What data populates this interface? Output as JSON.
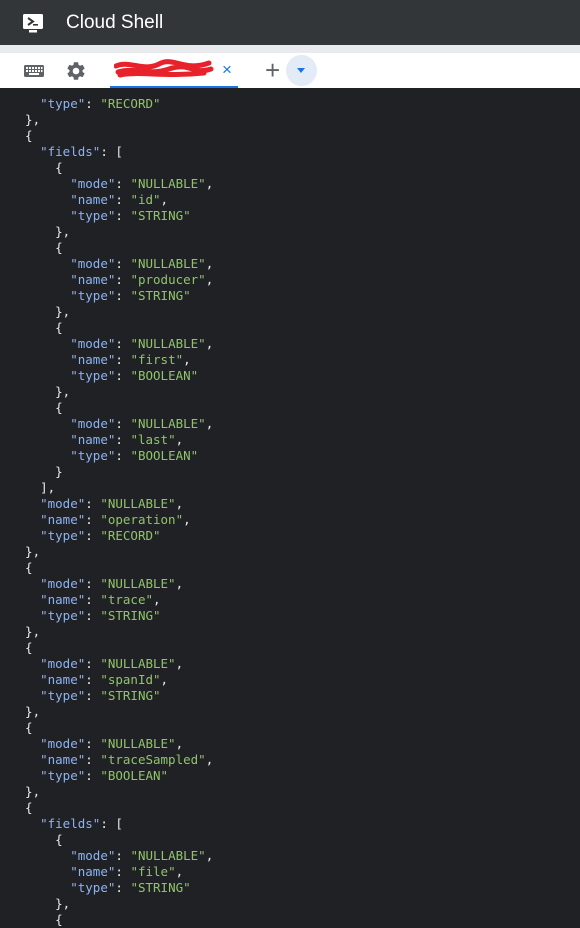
{
  "titlebar": {
    "title": "Cloud Shell",
    "icon": "cloud-shell-terminal-icon"
  },
  "toolbar": {
    "keyboard_icon": "keyboard-icon",
    "settings_icon": "gear-icon",
    "tab": {
      "label": "",
      "close_glyph": "×"
    },
    "add_tab_glyph": "+",
    "tab_menu_icon": "chevron-down-icon"
  },
  "colors": {
    "titlebar_bg": "#323639",
    "terminal_bg": "#202124",
    "key": "#8ab4f8",
    "string": "#8fc56a",
    "tab_accent": "#1a73e8"
  },
  "terminal": {
    "lines": [
      "    \"type\": \"RECORD\"",
      "  },",
      "  {",
      "    \"fields\": [",
      "      {",
      "        \"mode\": \"NULLABLE\",",
      "        \"name\": \"id\",",
      "        \"type\": \"STRING\"",
      "      },",
      "      {",
      "        \"mode\": \"NULLABLE\",",
      "        \"name\": \"producer\",",
      "        \"type\": \"STRING\"",
      "      },",
      "      {",
      "        \"mode\": \"NULLABLE\",",
      "        \"name\": \"first\",",
      "        \"type\": \"BOOLEAN\"",
      "      },",
      "      {",
      "        \"mode\": \"NULLABLE\",",
      "        \"name\": \"last\",",
      "        \"type\": \"BOOLEAN\"",
      "      }",
      "    ],",
      "    \"mode\": \"NULLABLE\",",
      "    \"name\": \"operation\",",
      "    \"type\": \"RECORD\"",
      "  },",
      "  {",
      "    \"mode\": \"NULLABLE\",",
      "    \"name\": \"trace\",",
      "    \"type\": \"STRING\"",
      "  },",
      "  {",
      "    \"mode\": \"NULLABLE\",",
      "    \"name\": \"spanId\",",
      "    \"type\": \"STRING\"",
      "  },",
      "  {",
      "    \"mode\": \"NULLABLE\",",
      "    \"name\": \"traceSampled\",",
      "    \"type\": \"BOOLEAN\"",
      "  },",
      "  {",
      "    \"fields\": [",
      "      {",
      "        \"mode\": \"NULLABLE\",",
      "        \"name\": \"file\",",
      "        \"type\": \"STRING\"",
      "      },",
      "      {"
    ]
  }
}
